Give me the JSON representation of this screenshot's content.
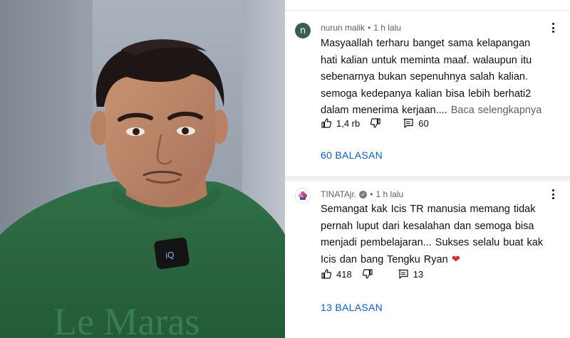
{
  "comments": [
    {
      "avatar_letter": "n",
      "author": "nurun malik",
      "time": "1 h lalu",
      "lines": [
        "Masyaallah  terharu banget sama  kelapangan",
        "hati kalian untuk  meminta maaf.  walaupun itu",
        "sebenarnya  bukan sepenuhnya salah kalian.",
        "semoga kedepanya kalian  bisa lebih berhati2",
        "dalam  menerima kerjaan...."
      ],
      "read_more": "Baca selengkapnya",
      "likes": "1,4 rb",
      "reply_count": "60",
      "replies_label": "60 BALASAN"
    },
    {
      "avatar_letter": "",
      "author": "TINATAjr.",
      "time": "1 h lalu",
      "lines": [
        "Semangat kak Icis TR manusia memang tidak",
        "pernah luput dari kesalahan dan semoga bisa",
        "menjadi pembelajaran... Sukses selalu buat kak",
        "Icis dan bang Tengku Ryan"
      ],
      "emoji": "❤",
      "likes": "418",
      "reply_count": "13",
      "replies_label": "13 BALASAN"
    }
  ],
  "photo": {
    "shirt_text": "Le Maras",
    "mic_text": "iQ"
  },
  "colors": {
    "link": "#065fd4",
    "avatar1": "#355f4e",
    "shirt": "#2e6b45"
  }
}
